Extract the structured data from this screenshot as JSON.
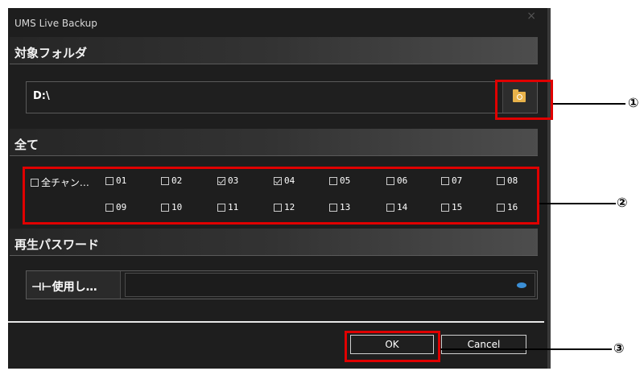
{
  "window": {
    "title": "UMS Live Backup",
    "close_glyph": "×"
  },
  "sections": {
    "target_folder": "対象フォルダ",
    "all": "全て",
    "playback_password": "再生パスワード"
  },
  "folder": {
    "path": "D:\\",
    "browse_icon": "folder-search-icon"
  },
  "channels": {
    "all_label": "全チャン…",
    "all_checked": false,
    "items": [
      {
        "label": "01",
        "checked": false
      },
      {
        "label": "02",
        "checked": false
      },
      {
        "label": "03",
        "checked": true
      },
      {
        "label": "04",
        "checked": true
      },
      {
        "label": "05",
        "checked": false
      },
      {
        "label": "06",
        "checked": false
      },
      {
        "label": "07",
        "checked": false
      },
      {
        "label": "08",
        "checked": false
      },
      {
        "label": "09",
        "checked": false
      },
      {
        "label": "10",
        "checked": false
      },
      {
        "label": "11",
        "checked": false
      },
      {
        "label": "12",
        "checked": false
      },
      {
        "label": "13",
        "checked": false
      },
      {
        "label": "14",
        "checked": false
      },
      {
        "label": "15",
        "checked": false
      },
      {
        "label": "16",
        "checked": false
      }
    ]
  },
  "password": {
    "toggle_label": "⊣⊢使用し…",
    "value": "",
    "eye_icon": "eye-icon"
  },
  "buttons": {
    "ok": "OK",
    "cancel": "Cancel"
  },
  "annotations": {
    "callout_1": "①",
    "callout_2": "②",
    "callout_3": "③",
    "highlight_color": "#e00000"
  },
  "colors": {
    "dialog_bg": "#1e1e1e",
    "folder_icon": "#e8b24a",
    "eye_icon": "#3b8fd6"
  }
}
